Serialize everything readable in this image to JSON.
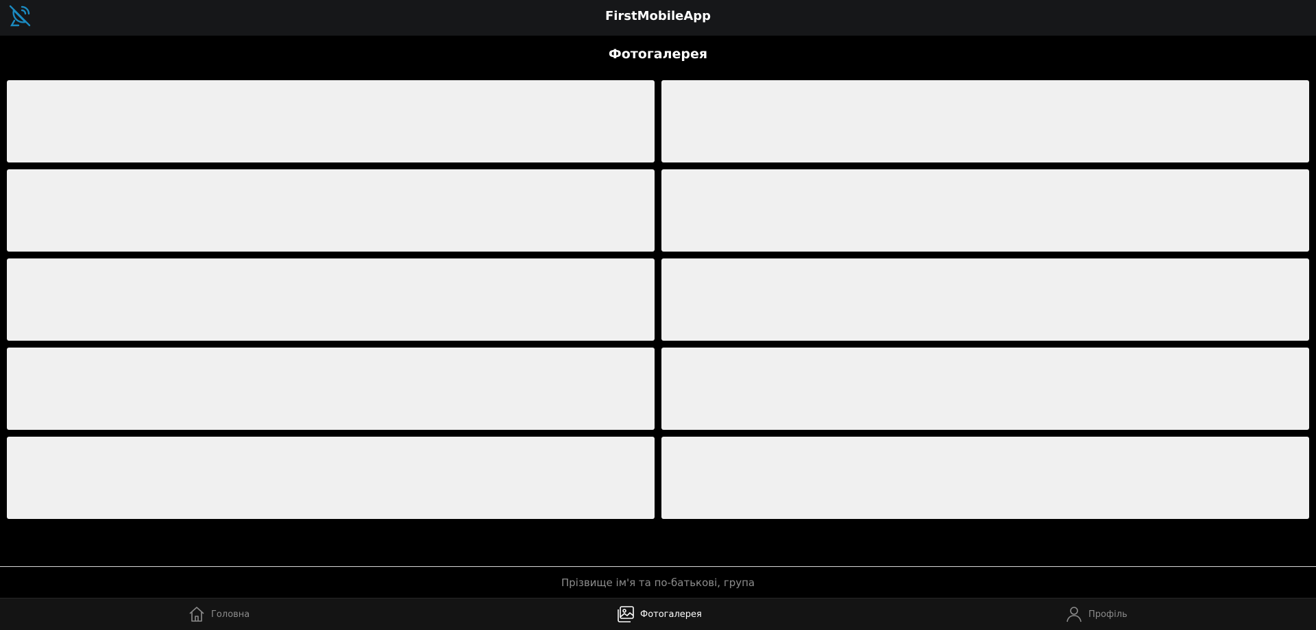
{
  "header": {
    "title": "FirstMobileApp",
    "logo_icon": "satellite-dish-icon",
    "accent_color": "#1b8ac0"
  },
  "page": {
    "title": "Фотогалерея"
  },
  "gallery": {
    "items": [
      {
        "label": ""
      },
      {
        "label": ""
      },
      {
        "label": ""
      },
      {
        "label": ""
      },
      {
        "label": ""
      },
      {
        "label": ""
      },
      {
        "label": ""
      },
      {
        "label": ""
      },
      {
        "label": ""
      },
      {
        "label": ""
      }
    ],
    "item_color": "#f0f0f0"
  },
  "footer": {
    "caption": "Прізвище ім'я та по-батькові, група"
  },
  "bottom_nav": {
    "items": [
      {
        "label": "Головна",
        "icon": "home-icon",
        "active": false
      },
      {
        "label": "Фотогалерея",
        "icon": "image-gallery-icon",
        "active": true
      },
      {
        "label": "Профіль",
        "icon": "user-icon",
        "active": false
      }
    ]
  }
}
